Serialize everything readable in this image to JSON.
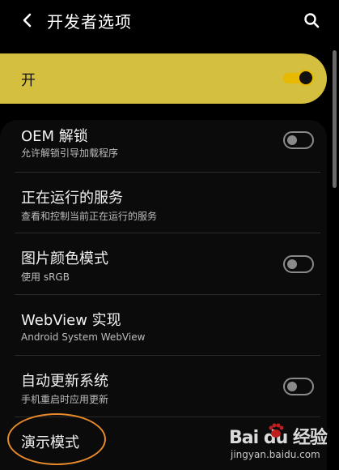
{
  "header": {
    "title": "开发者选项"
  },
  "master": {
    "label": "开",
    "enabled": true
  },
  "settings": [
    {
      "title": "OEM 解锁",
      "subtitle": "允许解锁引导加载程序",
      "toggle": "off"
    },
    {
      "title": "正在运行的服务",
      "subtitle": "查看和控制当前正在运行的服务",
      "toggle": null
    },
    {
      "title": "图片颜色模式",
      "subtitle": "使用 sRGB",
      "toggle": "off"
    },
    {
      "title": "WebView 实现",
      "subtitle": "Android System WebView",
      "toggle": null
    },
    {
      "title": "自动更新系统",
      "subtitle": "手机重启时应用更新",
      "toggle": "off"
    },
    {
      "title": "演示模式",
      "subtitle": "",
      "toggle": null
    }
  ],
  "watermark": {
    "brand": "Bai du 经验",
    "url": "jingyan.baidu.com"
  },
  "icons": {
    "back": "back-arrow-icon",
    "search": "search-icon",
    "paw": "baidu-paw-icon"
  },
  "colors": {
    "accent": "#d4c03e",
    "highlight": "#e88a2a",
    "background": "#000000"
  }
}
